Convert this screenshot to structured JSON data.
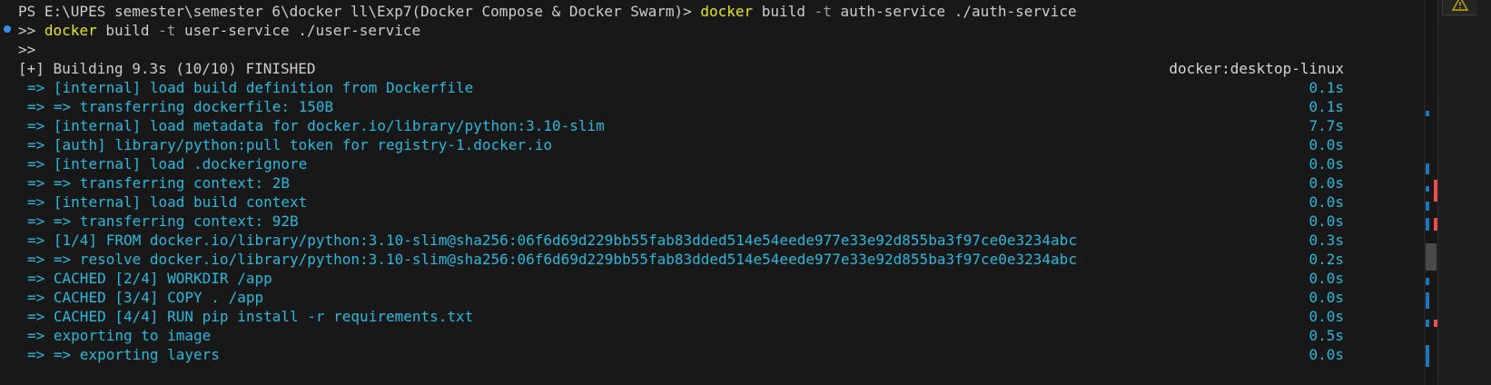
{
  "terminal": {
    "line1": {
      "prompt": "PS E:\\UPES semester\\semester 6\\docker ll\\Exp7(Docker Compose & Docker Swarm)> ",
      "cmd": "docker",
      "arg1": " build ",
      "flag": "-t",
      "arg2": " auth-service ./auth-service"
    },
    "line2": {
      "prompt": ">> ",
      "cmd": "docker",
      "arg1": " build ",
      "flag": "-t",
      "arg2": " user-service ./user-service"
    },
    "line3": {
      "prompt": ">>"
    },
    "build_header": {
      "text": "[+] Building 9.3s (10/10) FINISHED",
      "context": "docker:desktop-linux"
    },
    "steps": [
      {
        "arrow": "=>",
        "text": "[internal] load build definition from Dockerfile",
        "time": "0.1s",
        "style": "blue"
      },
      {
        "arrow": "=>",
        "text": "=> transferring dockerfile: 150B",
        "time": "0.1s",
        "style": "blue"
      },
      {
        "arrow": "=>",
        "text": "[internal] load metadata for docker.io/library/python:3.10-slim",
        "time": "7.7s",
        "style": "blue"
      },
      {
        "arrow": "=>",
        "text": "[auth] library/python:pull token for registry-1.docker.io",
        "time": "0.0s",
        "style": "blue"
      },
      {
        "arrow": "=>",
        "text": "[internal] load .dockerignore",
        "time": "0.0s",
        "style": "blue"
      },
      {
        "arrow": "=>",
        "text": "=> transferring context: 2B",
        "time": "0.0s",
        "style": "blue"
      },
      {
        "arrow": "=>",
        "text": "[internal] load build context",
        "time": "0.0s",
        "style": "blue"
      },
      {
        "arrow": "=>",
        "text": "=> transferring context: 92B",
        "time": "0.0s",
        "style": "blue"
      },
      {
        "arrow": "=>",
        "text": "[1/4] FROM docker.io/library/python:3.10-slim@sha256:06f6d69d229bb55fab83dded514e54eede977e33e92d855ba3f97ce0e3234abc",
        "time": "0.3s",
        "style": "blue"
      },
      {
        "arrow": "=>",
        "text": "=> resolve docker.io/library/python:3.10-slim@sha256:06f6d69d229bb55fab83dded514e54eede977e33e92d855ba3f97ce0e3234abc",
        "time": "0.2s",
        "style": "blue"
      },
      {
        "arrow": "=>",
        "text": "CACHED [2/4] WORKDIR /app",
        "time": "0.0s",
        "style": "blue"
      },
      {
        "arrow": "=>",
        "text": "CACHED [3/4] COPY . /app",
        "time": "0.0s",
        "style": "blue"
      },
      {
        "arrow": "=>",
        "text": "CACHED [4/4] RUN pip install -r requirements.txt",
        "time": "0.0s",
        "style": "blue"
      },
      {
        "arrow": "=>",
        "text": "exporting to image",
        "time": "0.5s",
        "style": "blue"
      },
      {
        "arrow": "=>",
        "text": "=> exporting layers",
        "time": "0.0s",
        "style": "blue"
      }
    ]
  },
  "icons": {
    "warning": "warning-icon",
    "decoration": "command-decoration-icon"
  },
  "colors": {
    "background": "#181818",
    "foreground": "#cccccc",
    "command": "#e5e510",
    "build_step": "#29b8db",
    "warning": "#cca700",
    "error_marker": "#f14c4c"
  }
}
